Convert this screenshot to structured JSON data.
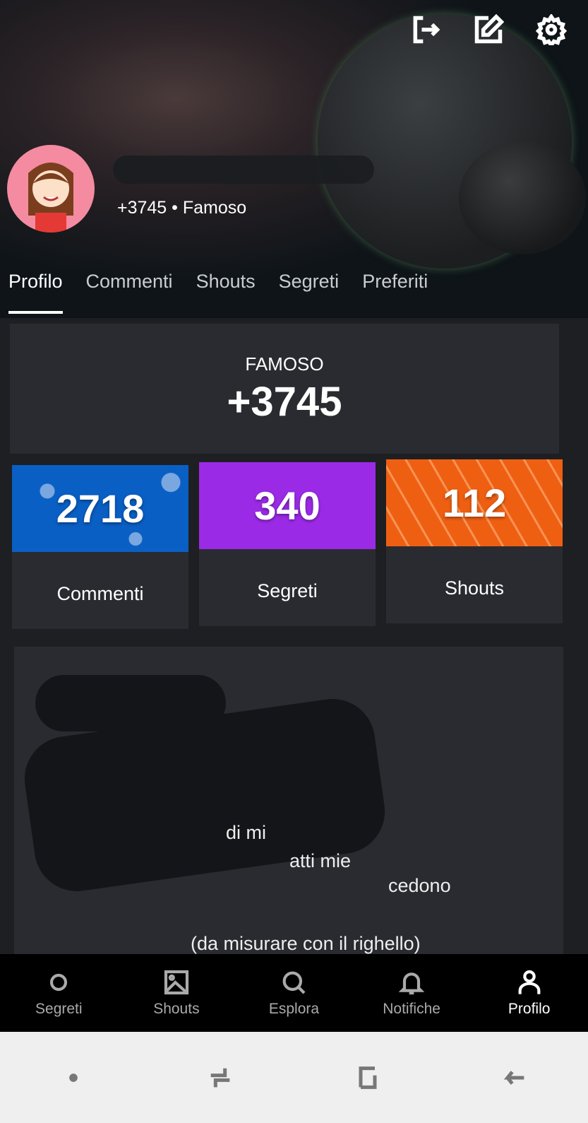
{
  "header": {
    "score_line": "+3745 • Famoso",
    "icons": [
      "logout-icon",
      "edit-icon",
      "gear-icon"
    ]
  },
  "tabs": [
    {
      "label": "Profilo",
      "active": true
    },
    {
      "label": "Commenti"
    },
    {
      "label": "Shouts"
    },
    {
      "label": "Segreti"
    },
    {
      "label": "Preferiti"
    }
  ],
  "rank": {
    "label": "FAMOSO",
    "value": "+3745"
  },
  "stats": [
    {
      "value": "2718",
      "label": "Commenti",
      "color": "#0a5fc4"
    },
    {
      "value": "340",
      "label": "Segreti",
      "color": "#9b2ae6"
    },
    {
      "value": "112",
      "label": "Shouts",
      "color": "#ef5f12"
    }
  ],
  "bio": {
    "lines": [
      "di mi",
      "atti mie",
      "cedono",
      "(da misurare con il righello)"
    ]
  },
  "nav": [
    {
      "label": "Segreti"
    },
    {
      "label": "Shouts"
    },
    {
      "label": "Esplora"
    },
    {
      "label": "Notifiche"
    },
    {
      "label": "Profilo",
      "active": true
    }
  ]
}
